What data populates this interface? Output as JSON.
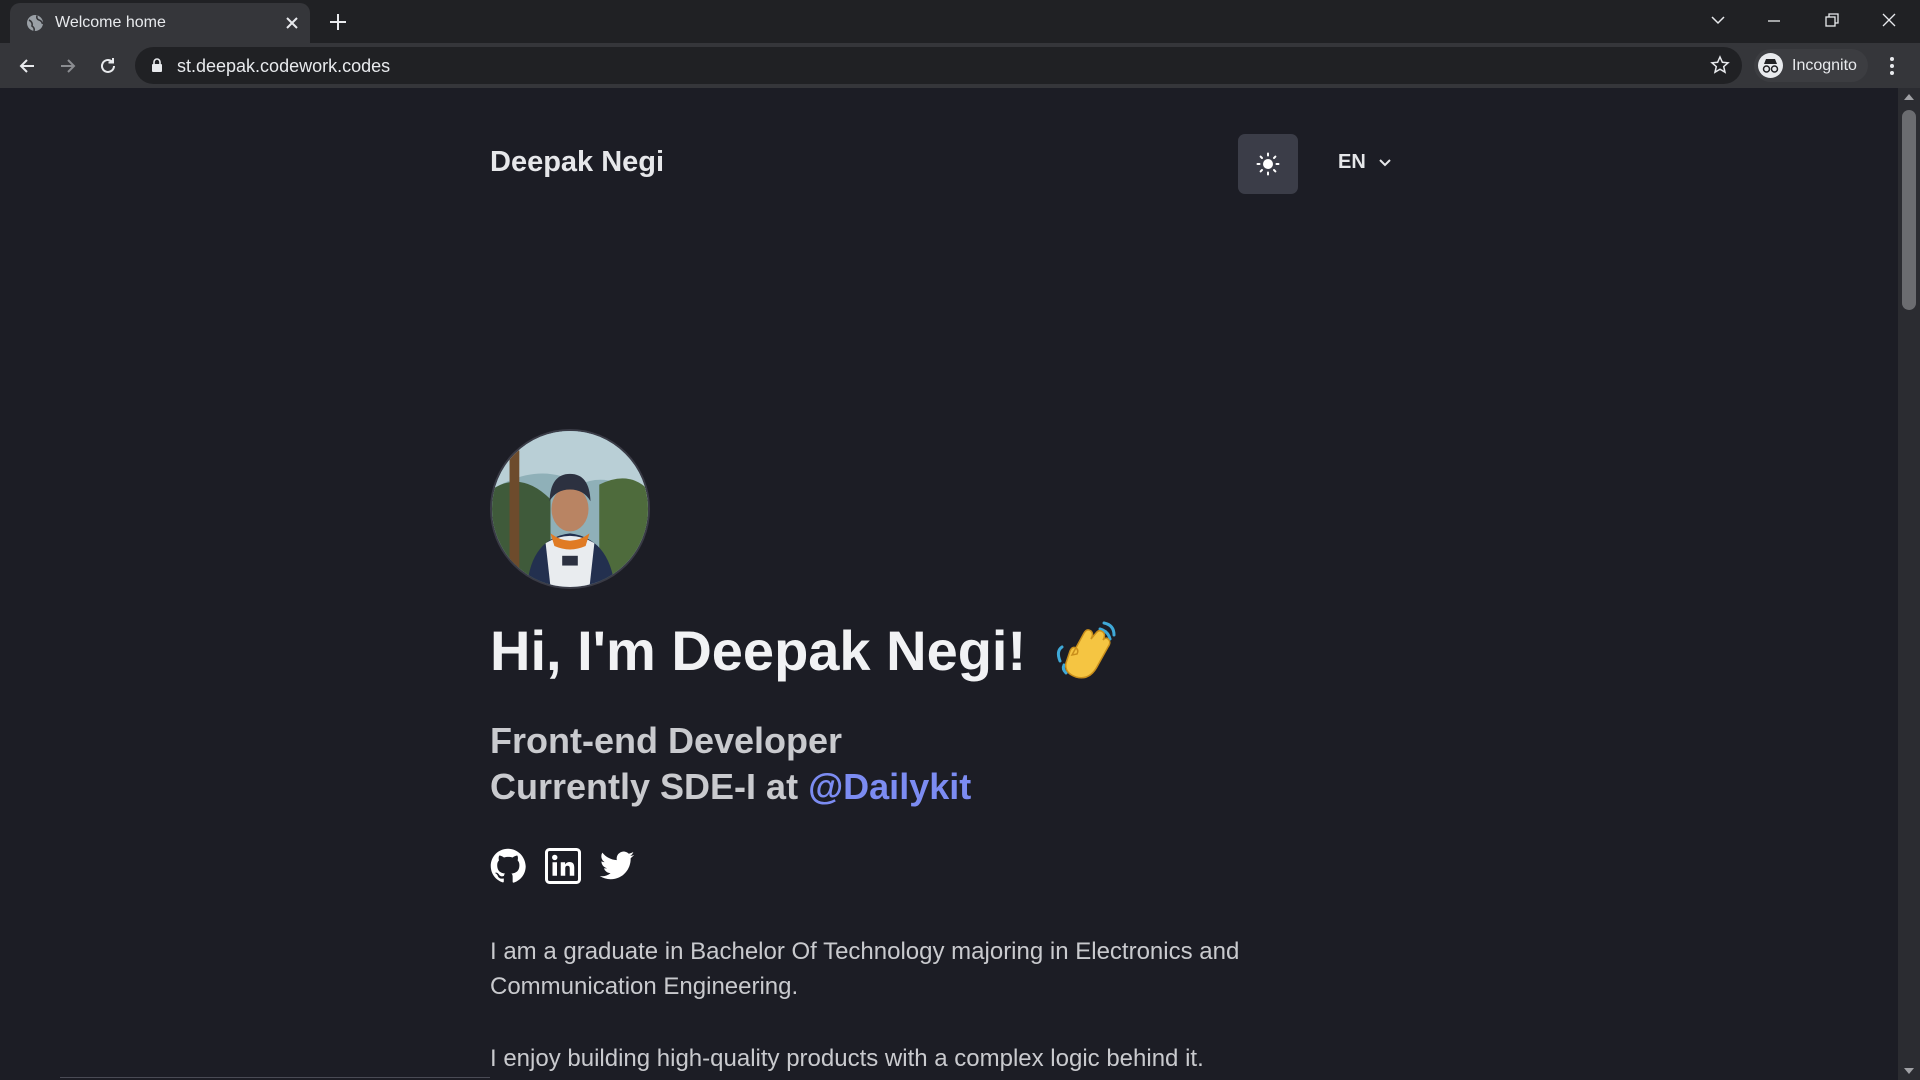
{
  "browser": {
    "tab_title": "Welcome home",
    "url": "st.deepak.codework.codes",
    "profile_label": "Incognito"
  },
  "site": {
    "brand": "Deepak Negi",
    "language": "EN"
  },
  "hero": {
    "greeting": "Hi, I'm Deepak Negi!",
    "role_line_1": "Front-end Developer",
    "role_line_2_prefix": "Currently SDE-I at ",
    "company": "@Dailykit",
    "social_links": [
      "github-icon",
      "linkedin-icon",
      "twitter-icon"
    ],
    "paragraphs": [
      "I am a graduate in Bachelor Of Technology majoring in Electronics and Communication Engineering.",
      "I enjoy building high-quality products with a complex logic behind it."
    ]
  },
  "colors": {
    "page_background": "#1c1d25",
    "accent": "#7c8cf2",
    "text": "#c9cace"
  }
}
